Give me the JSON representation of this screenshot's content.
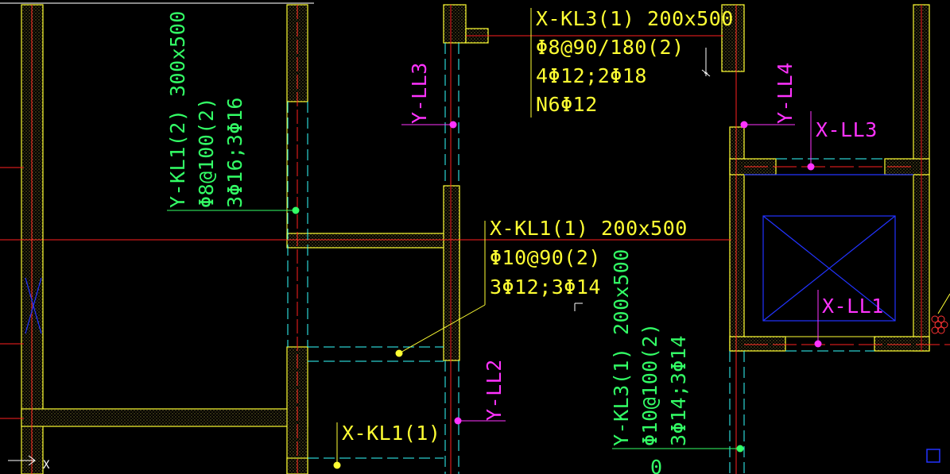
{
  "drawing": {
    "colors": {
      "background": "#000000",
      "wall": "#ffff33",
      "axis": "#ff2020",
      "beam_dashed": "#33ffff",
      "annotation_yellow": "#ffff33",
      "annotation_green": "#33ff66",
      "annotation_magenta": "#ff33ff",
      "shaft": "#2233ff"
    },
    "labels": {
      "xkl3": {
        "line1": "X-KL3(1) 200x500",
        "line2": "Φ8@90/180(2)",
        "line3": "4Φ12;2Φ18",
        "line4": "N6Φ12"
      },
      "xkl1": {
        "line1": "X-KL1(1) 200x500",
        "line2": "Φ10@90(2)",
        "line3": "3Φ12;3Φ14"
      },
      "xkl1_short": "X-KL1(1)",
      "ykl1": {
        "line1": "Y-KL1(2) 300x500",
        "line2": "Φ8@100(2)",
        "line3": "3Φ16;3Φ16"
      },
      "ykl3": {
        "line1": "Y-KL3(1) 200x500",
        "line2": "Φ10@100(2)",
        "line3": "3Φ14;3Φ14"
      },
      "yll3": "Y-LL3",
      "yll4": "Y-LL4",
      "yll2": "Y-LL2",
      "xll3": "X-LL3",
      "xll1": "X-LL1",
      "ucs_x": "X",
      "partial_zero": "0"
    },
    "icons": [
      "ucs-axis-icon",
      "cursor-crosshair-icon",
      "elevator-shaft-icon",
      "hatch-pattern-icon",
      "corner-square-icon"
    ]
  }
}
